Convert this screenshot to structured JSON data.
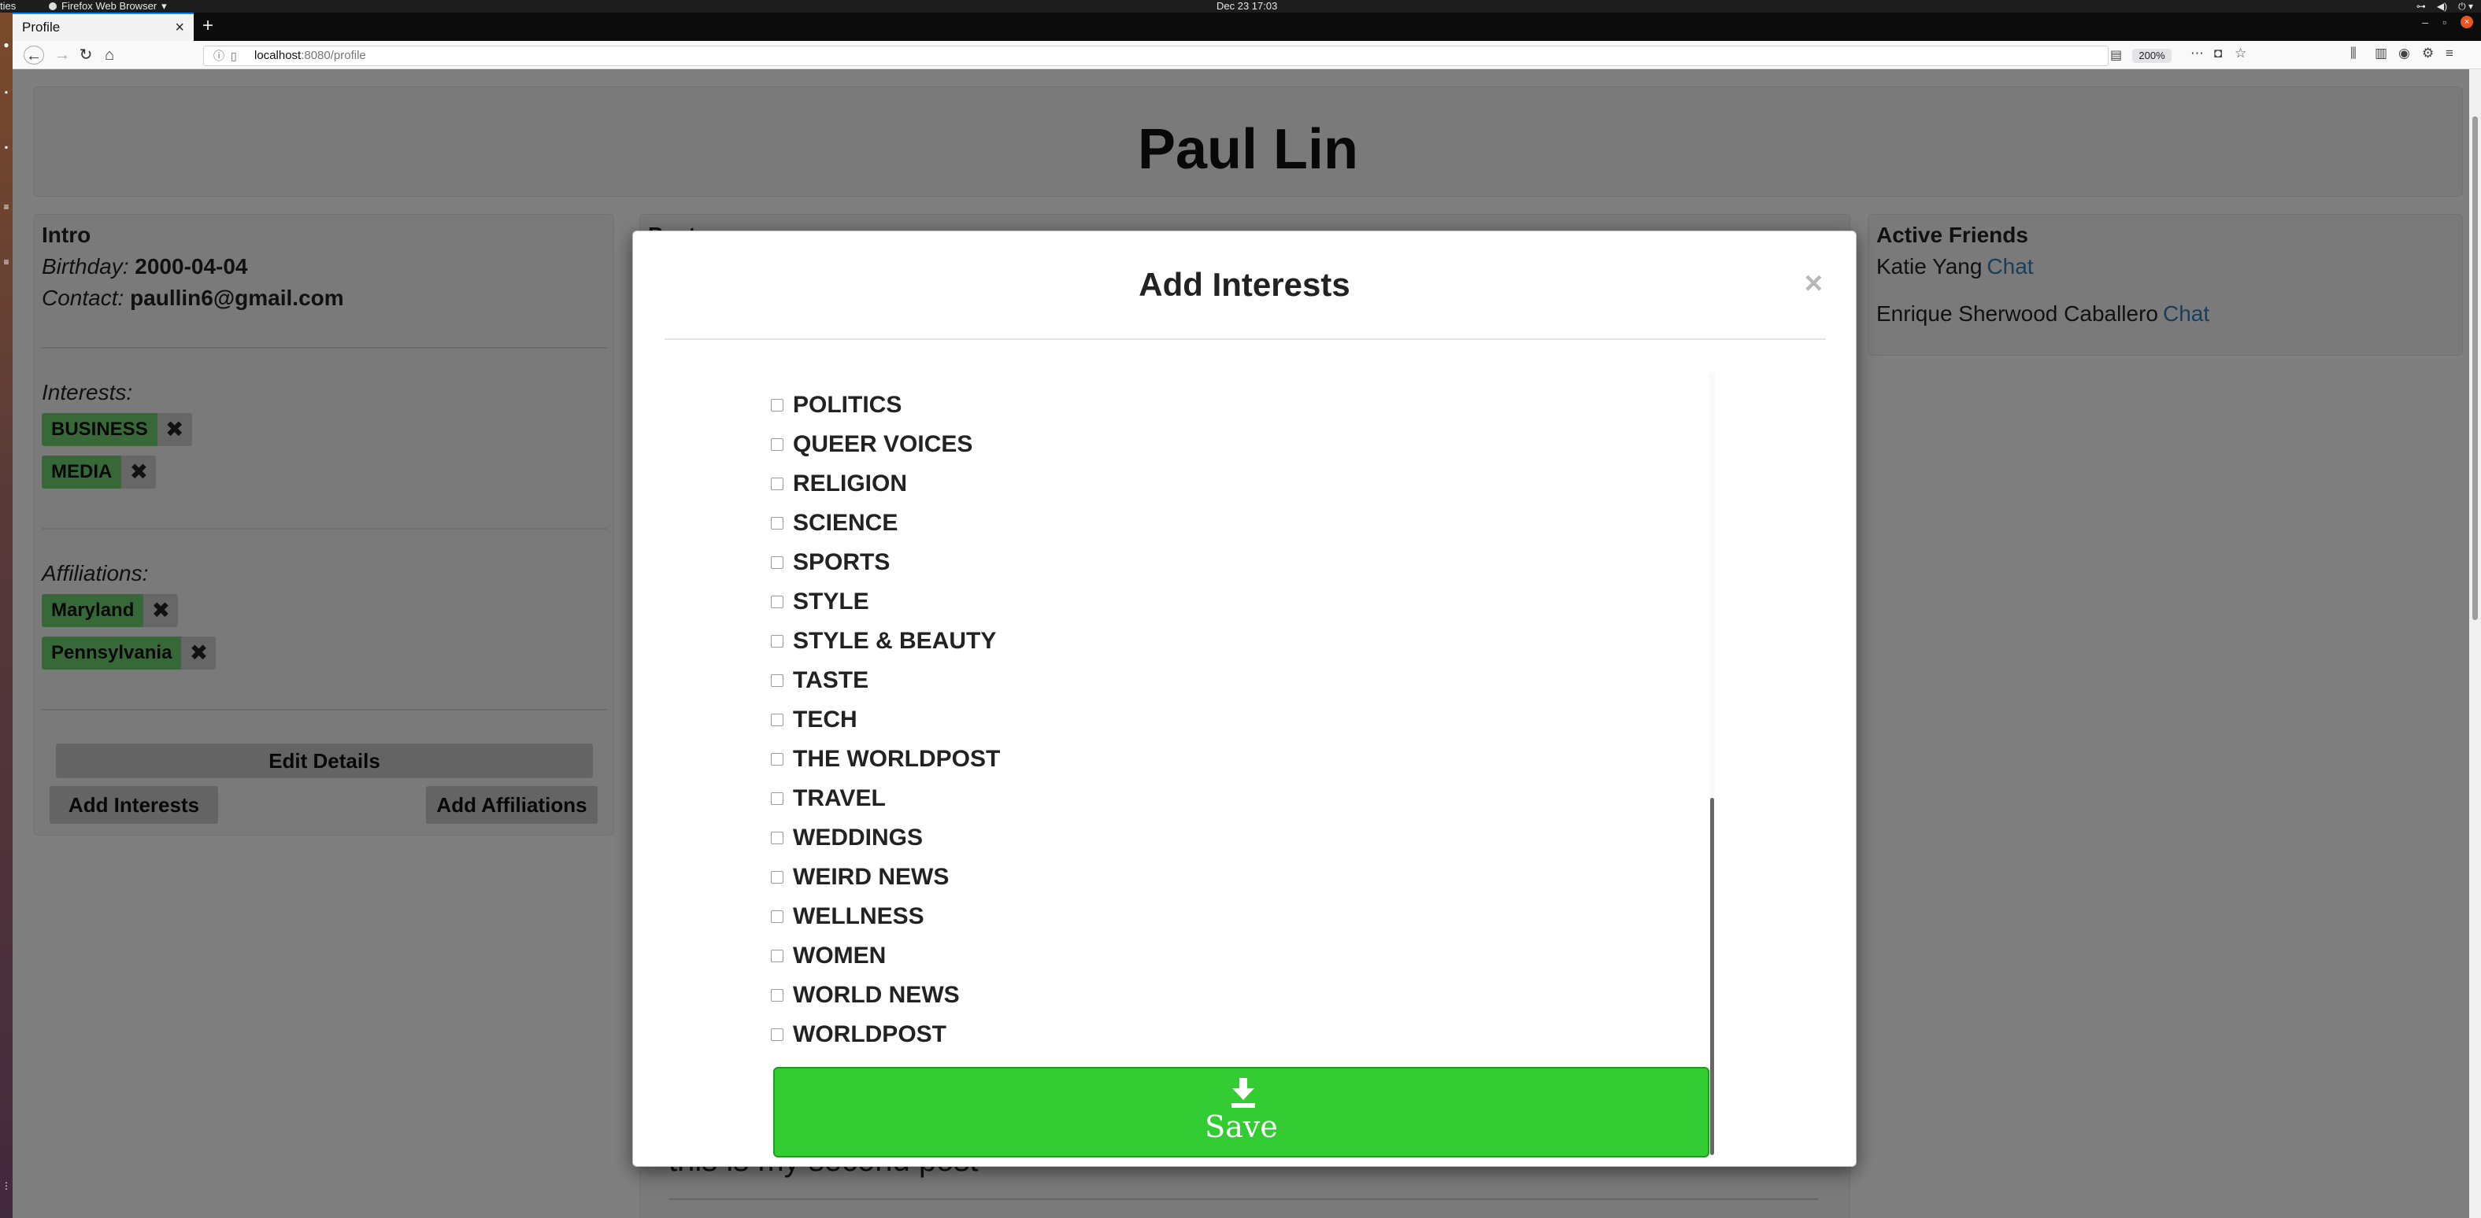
{
  "os": {
    "activities": "ties",
    "app_name": "Firefox Web Browser",
    "clock": "Dec 23  17:03"
  },
  "browser": {
    "tab_title": "Profile",
    "url_host": "localhost",
    "url_path": ":8080/profile",
    "zoom": "200%"
  },
  "profile": {
    "name": "Paul Lin",
    "intro": {
      "title": "Intro",
      "birthday_label": "Birthday:",
      "birthday": "2000-04-04",
      "contact_label": "Contact:",
      "contact": "paullin6@gmail.com"
    },
    "interests_label": "Interests:",
    "interests": [
      "BUSINESS",
      "MEDIA"
    ],
    "affiliations_label": "Affiliations:",
    "affiliations": [
      "Maryland",
      "Pennsylvania"
    ],
    "buttons": {
      "edit_details": "Edit Details",
      "add_interests": "Add Interests",
      "add_affiliations": "Add Affiliations"
    }
  },
  "posts": {
    "title": "Posts",
    "visible_post": "this is my second post"
  },
  "friends": {
    "title": "Active Friends",
    "chat_label": "Chat",
    "list": [
      "Katie Yang",
      "Enrique Sherwood Caballero"
    ]
  },
  "modal": {
    "title": "Add Interests",
    "close": "×",
    "options": [
      "POLITICS",
      "QUEER VOICES",
      "RELIGION",
      "SCIENCE",
      "SPORTS",
      "STYLE",
      "STYLE & BEAUTY",
      "TASTE",
      "TECH",
      "THE WORLDPOST",
      "TRAVEL",
      "WEDDINGS",
      "WEIRD NEWS",
      "WELLNESS",
      "WOMEN",
      "WORLD NEWS",
      "WORLDPOST"
    ],
    "save_label": "Save",
    "scroll_position": 0.54
  },
  "colors": {
    "tag_green": "#6fd06f",
    "save_green": "#33cc33",
    "link_blue": "#337ab7"
  }
}
